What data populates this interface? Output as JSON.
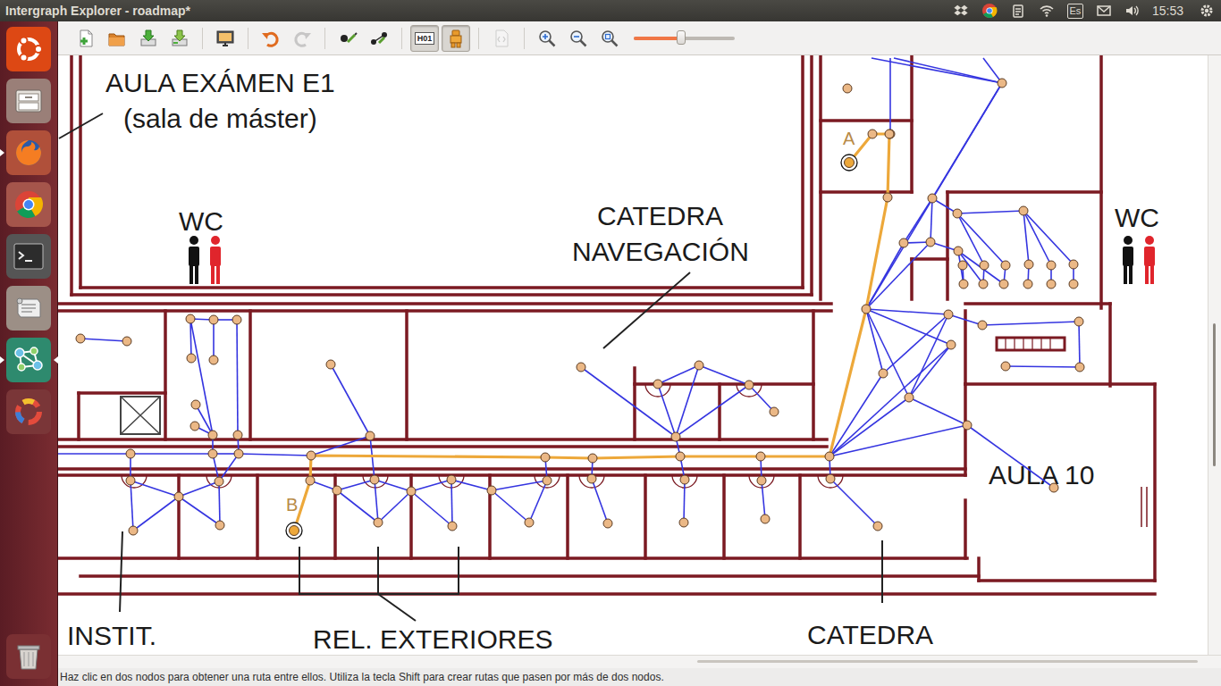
{
  "top_panel": {
    "title": "Intergraph Explorer - roadmap*",
    "keyboard": "Es",
    "time": "15:53"
  },
  "launcher": {
    "items": [
      {
        "running": false,
        "focused": false
      },
      {
        "running": false,
        "focused": false
      },
      {
        "running": true,
        "focused": false
      },
      {
        "running": false,
        "focused": false
      },
      {
        "running": false,
        "focused": false
      },
      {
        "running": false,
        "focused": false
      },
      {
        "running": true,
        "focused": true
      },
      {
        "running": false,
        "focused": false
      },
      {
        "running": false,
        "focused": false
      }
    ]
  },
  "toolbar": {
    "buttons": [
      {
        "pressed": false,
        "disabled": false
      },
      {
        "pressed": false,
        "disabled": false
      },
      {
        "pressed": false,
        "disabled": false
      },
      {
        "pressed": false,
        "disabled": false
      },
      {
        "pressed": false,
        "disabled": false
      },
      {
        "pressed": false,
        "disabled": false
      },
      {
        "pressed": false,
        "disabled": true
      },
      {
        "pressed": false,
        "disabled": false
      },
      {
        "pressed": false,
        "disabled": false
      },
      {
        "pressed": true,
        "disabled": false,
        "label": "H01"
      },
      {
        "pressed": true,
        "disabled": false
      },
      {
        "pressed": false,
        "disabled": true
      },
      {
        "pressed": false,
        "disabled": false
      },
      {
        "pressed": false,
        "disabled": false
      },
      {
        "pressed": false,
        "disabled": false
      }
    ],
    "zoom": {
      "level": 0.47
    }
  },
  "map": {
    "labels": [
      {
        "text": "AULA EXÁMEN E1"
      },
      {
        "text": "(sala de máster)"
      },
      {
        "text": "WC"
      },
      {
        "text": "CATEDRA"
      },
      {
        "text": "NAVEGACIÓN"
      },
      {
        "text": "WC"
      },
      {
        "text": "AULA 10"
      },
      {
        "text": "INSTIT."
      },
      {
        "text": "REL. EXTERIORES"
      },
      {
        "text": "CATEDRA"
      }
    ]
  },
  "graph": {
    "start_label": "A",
    "end_label": "B",
    "route_shown": true
  },
  "status_bar": "Haz clic en dos nodos para obtener una ruta entre ellos. Utiliza la tecla Shift para crear rutas que pasen por más de dos nodos."
}
